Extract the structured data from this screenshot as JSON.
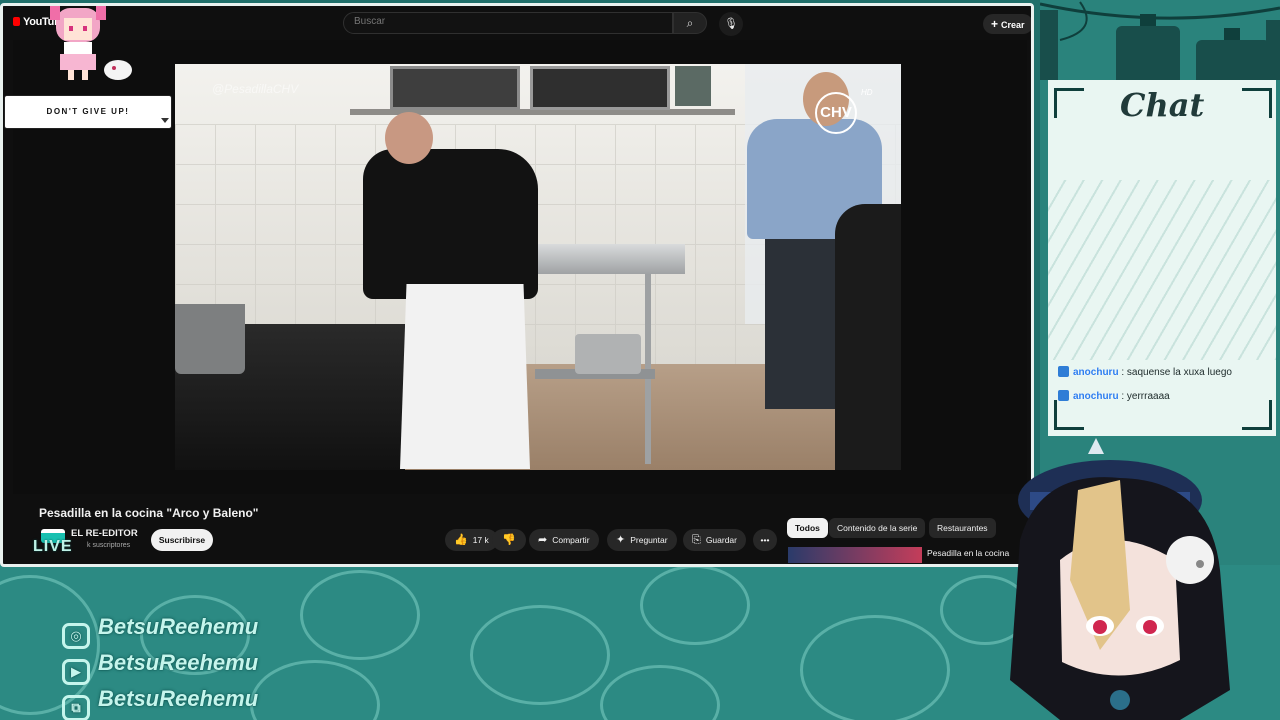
{
  "browser": {
    "logo_text": "YouTube",
    "search_placeholder": "Buscar",
    "create_label": "Crear"
  },
  "video": {
    "watermark": "@PesadillaCHV",
    "channel_bug": "CHV",
    "hd_tag": "HD",
    "title": "Pesadilla en la cocina \"Arco y Baleno\"",
    "channel_name": "EL RE-EDITOR",
    "subscribers": "k suscriptores",
    "subscribe_label": "Suscribirse",
    "likes": "17 k",
    "share_label": "Compartir",
    "ask_label": "Preguntar",
    "save_label": "Guardar",
    "more_label": "•••"
  },
  "recommendations": {
    "chips": [
      "Todos",
      "Contenido de la serie",
      "Restaurantes"
    ],
    "first_title": "Pesadilla en la cocina"
  },
  "overlay": {
    "speech": "DON'T GIVE UP!",
    "live_label": "LIVE",
    "chat_title": "Chat",
    "socials": [
      {
        "icon": "instagram-icon",
        "glyph": "◎",
        "handle": "BetsuReehemu"
      },
      {
        "icon": "youtube-icon",
        "glyph": "▶",
        "handle": "BetsuReehemu"
      },
      {
        "icon": "twitch-icon",
        "glyph": "⧉",
        "handle": "BetsuReehemu"
      }
    ]
  },
  "chat": {
    "messages": [
      {
        "user": "anochuru",
        "text": ": saquense la xuxa luego"
      },
      {
        "user": "anochuru",
        "text": ": yerrraaaa"
      }
    ]
  },
  "colors": {
    "teal": "#2c8a83",
    "panel": "#e9f6f2",
    "youtube_red": "#ff0000",
    "chat_user": "#2c7df0"
  }
}
